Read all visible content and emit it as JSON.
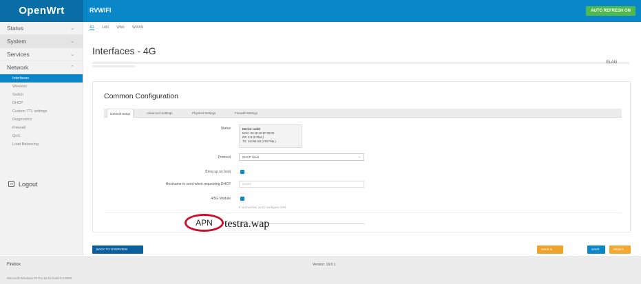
{
  "header": {
    "brand": "OpenWrt",
    "hostname": "RVWIFI",
    "refresh_button": "AUTO REFRESH ON"
  },
  "sidebar": {
    "menu": [
      {
        "label": "Status",
        "chevron": "⌄"
      },
      {
        "label": "System",
        "chevron": "⌄"
      },
      {
        "label": "Services",
        "chevron": "⌄"
      },
      {
        "label": "Network",
        "chevron": "⌃"
      }
    ],
    "network_items": [
      "Interfaces",
      "Wireless",
      "Switch",
      "DHCP",
      "Custom TTL settings",
      "Diagnostics",
      "Firewall",
      "QoS",
      "Load Balancing"
    ],
    "logout": "Logout"
  },
  "subtabs": [
    "4G",
    "LAN",
    "WAN",
    "WWAN"
  ],
  "page": {
    "title": "Interfaces - 4G",
    "desc_keyword": "ELAN"
  },
  "panel": {
    "title": "Common Configuration",
    "tabs": [
      "General Setup",
      "Advanced Settings",
      "Physical Settings",
      "Firewall Settings"
    ],
    "rows": {
      "status_label": "Status",
      "status_device": "Device: usb0",
      "status_mac": "MAC: 02:1E:10:1F:00:00",
      "status_rx": "RX: 0 B (0 Pkts.)",
      "status_tx": "TX: 143.95 KB (478 Pkts.)",
      "protocol_label": "Protocol",
      "protocol_value": "DHCP client",
      "bring_up_label": "Bring up on boot",
      "hostname_label": "Hostname to send when requesting DHCP",
      "hostname_placeholder": "Dexter",
      "module_label": "4/5G Module",
      "module_hint": "If unchecked, won't configure APN"
    }
  },
  "annotation": {
    "apn_label": "APN",
    "apn_value": "testra.wap"
  },
  "buttons": {
    "back": "BACK TO OVERVIEW",
    "save_apply": "SAVE & APPLY",
    "save": "SAVE",
    "reset": "RESET"
  },
  "footer": {
    "label": "Firebox",
    "sub": "Microsoft Windows 10 Pro 64-bit build 6.2.9200",
    "version": "Version: 19.0.1"
  },
  "colors": {
    "header_blue": "#0a87c8",
    "refresh_green": "#4fb84b",
    "annotation_red": "#c8102e",
    "button_orange": "#f0a32b"
  }
}
